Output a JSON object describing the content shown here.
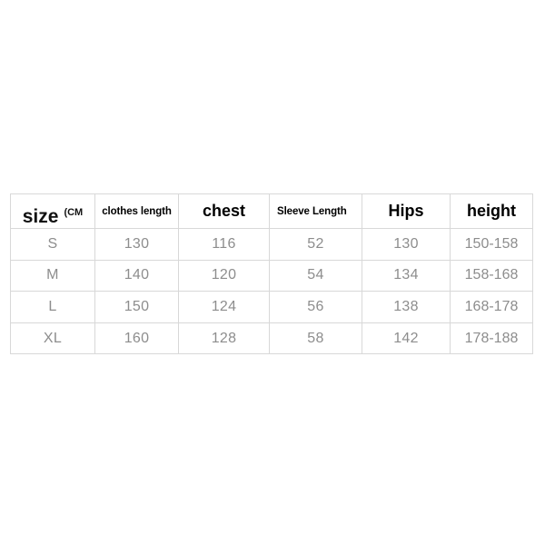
{
  "table": {
    "headers": [
      {
        "key": "size",
        "label": "size",
        "unit": "(CM",
        "style": "size"
      },
      {
        "key": "clothes_length",
        "label": "clothes length",
        "style": "small"
      },
      {
        "key": "chest",
        "label": "chest",
        "style": "big"
      },
      {
        "key": "sleeve_length",
        "label": "Sleeve Length",
        "style": "small"
      },
      {
        "key": "hips",
        "label": "Hips",
        "style": "big"
      },
      {
        "key": "height",
        "label": "height",
        "style": "big"
      }
    ],
    "rows": [
      {
        "size": "S",
        "clothes_length": "130",
        "chest": "116",
        "sleeve_length": "52",
        "hips": "130",
        "height": "150-158"
      },
      {
        "size": "M",
        "clothes_length": "140",
        "chest": "120",
        "sleeve_length": "54",
        "hips": "134",
        "height": "158-168"
      },
      {
        "size": "L",
        "clothes_length": "150",
        "chest": "124",
        "sleeve_length": "56",
        "hips": "138",
        "height": "168-178"
      },
      {
        "size": "XL",
        "clothes_length": "160",
        "chest": "128",
        "sleeve_length": "58",
        "hips": "142",
        "height": "178-188"
      }
    ]
  },
  "colors": {
    "background": "#ffffff",
    "border": "#d8d8d8",
    "header_text": "#111111",
    "data_text": "#8d8d8d"
  }
}
